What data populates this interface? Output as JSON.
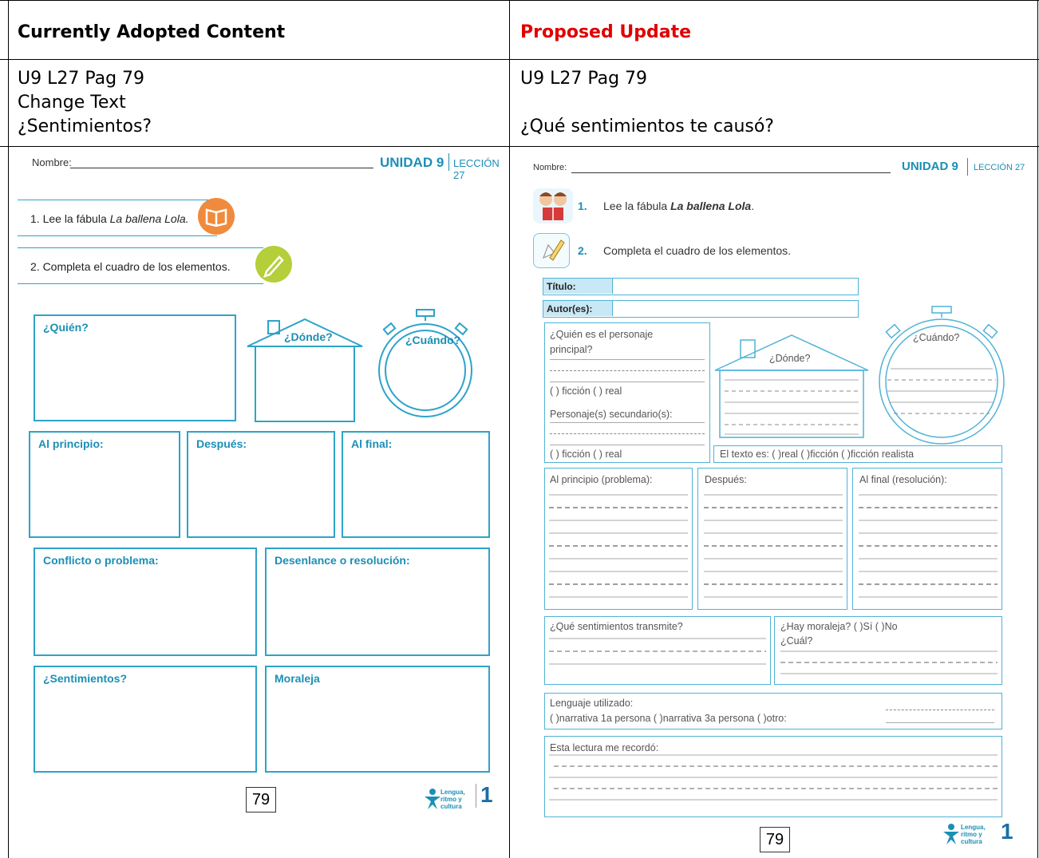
{
  "table": {
    "header_left": "Currently Adopted Content",
    "header_right": "Proposed Update",
    "header_right_color": "#e00000",
    "left_ref": "U9 L27 Pag 79",
    "left_change": "Change Text",
    "left_old": "¿Sentimientos?",
    "right_ref": "U9 L27 Pag 79",
    "right_new": "¿Qué sentimientos te causó?"
  },
  "left_page": {
    "nombre": "Nombre:",
    "unidad": "UNIDAD 9",
    "leccion": "LECCIÓN 27",
    "step1_prefix": "1. Lee la fábula ",
    "step1_title": "La ballena Lola.",
    "step2": "2. Completa el cuadro de los elementos.",
    "quien": "¿Quién?",
    "donde": "¿Dónde?",
    "cuando": "¿Cuándo?",
    "al_principio": "Al principio:",
    "despues": "Después:",
    "al_final": "Al final:",
    "conflicto": "Conflicto o problema:",
    "desenlace": "Desenlance o resolución:",
    "sentimientos": "¿Sentimientos?",
    "moraleja": "Moraleja",
    "page_number": "79",
    "logo_text": "Lengua, ritmo y cultura",
    "logo_num": "1"
  },
  "right_page": {
    "nombre": "Nombre:",
    "unidad": "UNIDAD 9",
    "leccion": "LECCIÓN 27",
    "step1_num": "1.",
    "step1_prefix": "Lee la fábula ",
    "step1_title": "La ballena Lola",
    "step1_suffix": ".",
    "step2_num": "2.",
    "step2": "Completa el cuadro de los elementos.",
    "titulo": "Título:",
    "autores": "Autor(es):",
    "quien_1": "¿Quién es el personaje",
    "quien_2": "principal?",
    "ficcion_real": "(    ) ficción      (    ) real",
    "secundarios": "Personaje(s) secundario(s):",
    "ficcion_real_2": "(    ) ficción      (    ) real",
    "donde": "¿Dónde?",
    "cuando": "¿Cuándo?",
    "texto_es": "El texto es: (     )real      (     )ficción      (     )ficción realista",
    "al_principio": "Al principio (problema):",
    "despues": "Después:",
    "al_final": "Al final (resolución):",
    "sentimientos": "¿Qué sentimientos transmite?",
    "moraleja_1": "¿Hay moraleja?     (     )Sí      (     )No",
    "moraleja_2": "¿Cuál?",
    "lenguaje": "Lenguaje utilizado:",
    "lenguaje_opts": "(     )narrativa 1a persona      (     )narrativa 3a persona      (     )otro:",
    "recordo": "Esta lectura me recordó:",
    "page_number": "79",
    "logo_text": "Lengua, ritmo y cultura",
    "logo_num": "1"
  }
}
